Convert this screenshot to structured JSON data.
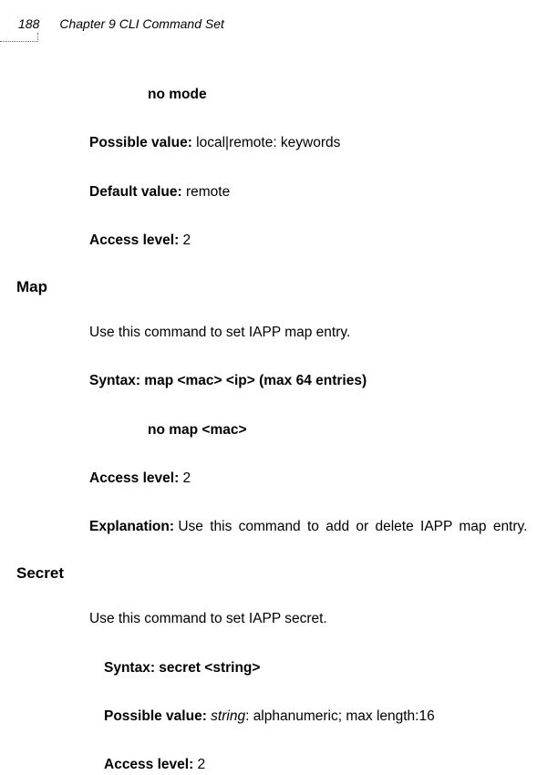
{
  "header": {
    "page_number": "188",
    "chapter_title": "Chapter 9 CLI Command Set"
  },
  "lines": {
    "no_mode": "no mode",
    "possible_value_label": "Possible value: ",
    "possible_value_text": "local|remote: keywords",
    "default_value_label": "Default value: ",
    "default_value_text": "remote",
    "access_level_label": "Access level: ",
    "access_level_text": "2"
  },
  "map_section": {
    "heading": "Map",
    "description": "Use this command to set IAPP map entry.",
    "syntax": "Syntax: map <mac> <ip> (max 64 entries)",
    "no_map": "no map <mac>",
    "access_level_label": "Access level:  ",
    "access_level_text": "2",
    "explanation_label": "Explanation: ",
    "explanation_text": "Use this command to add or delete IAPP map entry."
  },
  "secret_section": {
    "heading": "Secret",
    "description": "Use this command to set IAPP secret.",
    "syntax": "Syntax: secret <string>",
    "possible_value_label": "Possible value: ",
    "possible_value_string": "string",
    "possible_value_text": ": alphanumeric; max length:16",
    "access_level_label": "Access level: ",
    "access_level_text": "2"
  }
}
